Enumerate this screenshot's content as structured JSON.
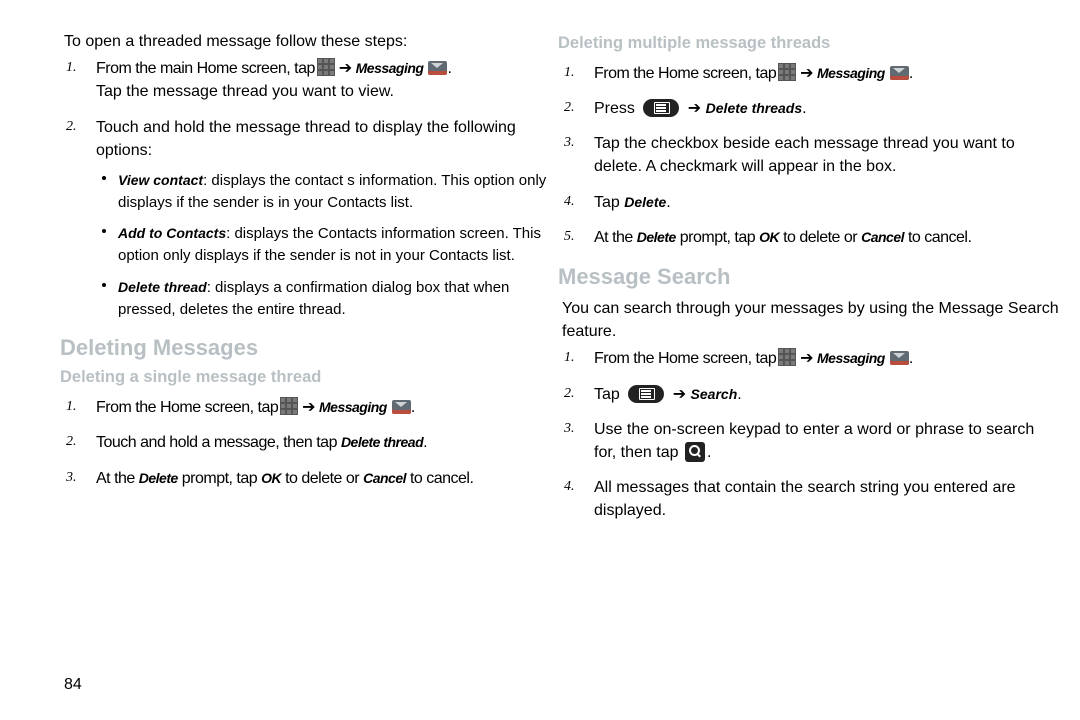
{
  "page_number": "84",
  "left": {
    "intro": "To open a threaded message follow these steps:",
    "step1a": "From the main Home screen",
    "step1a_tap": "tap",
    "step1a_label": "Messaging",
    "step1b": "Tap the message thread you want to view.",
    "step2": "Touch and hold the message thread to display the following options:",
    "b1_term": "View contact",
    "b1_rest": ": displays the contact s information. This option only displays if the sender is in your Contacts list.",
    "b2_term": "Add to Contacts",
    "b2_rest": ": displays the Contacts information screen. This option only displays if the sender is not in your Contacts list.",
    "b3_term": "Delete thread",
    "b3_rest": ": displays a confirmation dialog box that when pressed, deletes the entire thread.",
    "h2": "Deleting Messages",
    "h3": "Deleting a single message thread",
    "d1a": "From the Home screen",
    "d1_tap": "tap",
    "d1_label": "Messaging",
    "d2a": "Touch and hold a message, then",
    "d2_tap": "tap",
    "d2_term": "Delete thread",
    "d3a": "At the",
    "d3_del": "Delete",
    "d3b": " prompt, tap",
    "d3_ok": "OK",
    "d3c": " to delete or",
    "d3_cancel": "Cancel",
    "d3d": " to cancel."
  },
  "right": {
    "h3a": "Deleting multiple message threads",
    "m1a": "From the Home screen",
    "m1_tap": "tap",
    "m1_label": "Messaging",
    "m2a": "Press",
    "m2_term": "Delete threads",
    "m3": "Tap the checkbox beside each message thread you want to delete. A check",
    "m3_mark": "mark",
    "m3b": " will appear in the box.",
    "m4a": "Tap",
    "m4_del": "Delete",
    "m5a": "At the",
    "m5_del": "Delete",
    "m5b": " prompt, tap",
    "m5_ok": "OK",
    "m5c": " to delete or",
    "m5_cancel": "Cancel",
    "m5d": " to cancel.",
    "h2": "Message Search",
    "intro2": "You can search through your messages by using the Message Search feature.",
    "s1a": "From the Home screen",
    "s1_tap": "tap",
    "s1_label": "Messaging",
    "s2a": "Tap",
    "s2_term": "Search",
    "s3": "Use the on-screen keypad to enter a word or phrase to search for, then tap",
    "s4": "All messages that contain the search string you entered are displayed."
  }
}
